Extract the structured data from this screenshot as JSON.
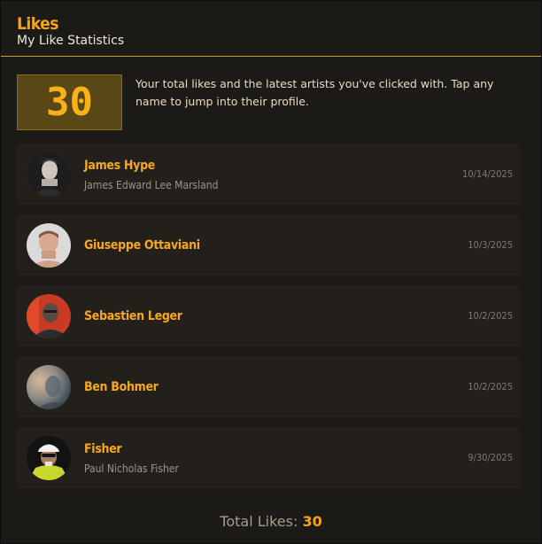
{
  "header": {
    "title": "Likes",
    "subtitle": "My Like Statistics"
  },
  "summary": {
    "total": "30",
    "intro": "Your total likes and the latest artists you've clicked with. Tap any name to jump into their profile."
  },
  "artists": [
    {
      "name": "James Hype",
      "real_name": "James Edward Lee Marsland",
      "date": "10/14/2025"
    },
    {
      "name": "Giuseppe Ottaviani",
      "real_name": "",
      "date": "10/3/2025"
    },
    {
      "name": "Sebastien Leger",
      "real_name": "",
      "date": "10/2/2025"
    },
    {
      "name": "Ben Bohmer",
      "real_name": "",
      "date": "10/2/2025"
    },
    {
      "name": "Fisher",
      "real_name": "Paul Nicholas Fisher",
      "date": "9/30/2025"
    }
  ],
  "footer": {
    "label": "Total Likes:",
    "total": "30"
  },
  "colors": {
    "accent": "#f5a515",
    "background": "#1c1a17",
    "card": "#23201c"
  }
}
